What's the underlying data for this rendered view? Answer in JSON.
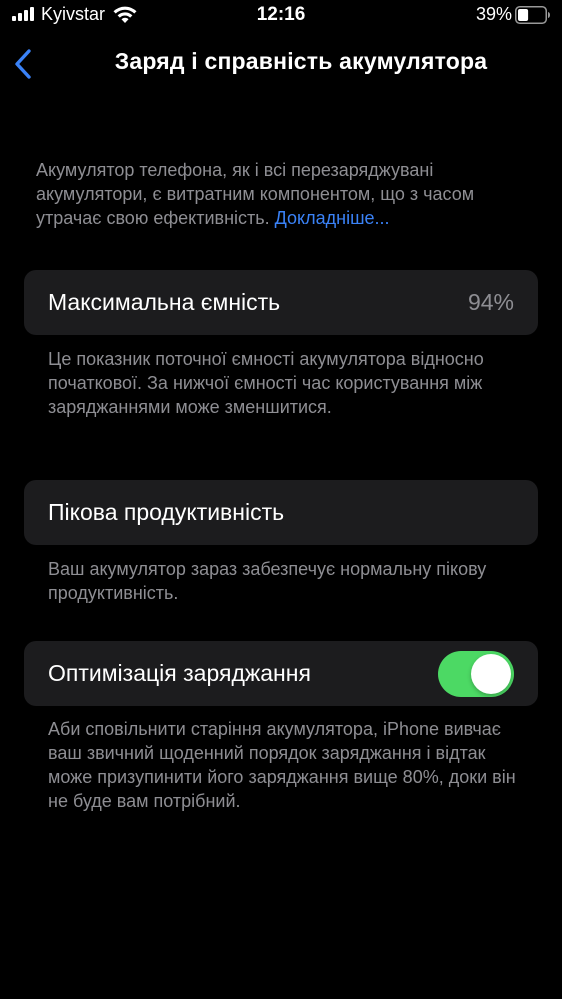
{
  "status_bar": {
    "carrier": "Kyivstar",
    "time": "12:16",
    "battery_percent": "39%",
    "battery_level": 0.39,
    "signal_icon": "signal-bars-icon",
    "wifi_icon": "wifi-icon",
    "battery_icon": "battery-icon"
  },
  "nav": {
    "title": "Заряд і справність акумулятора",
    "back_icon": "chevron-left-icon",
    "accent_color": "#3a82f7"
  },
  "intro": {
    "text": "Акумулятор телефона, як і всі перезаряджувані акумулятори, є витратним компонентом, що з часом утрачає свою ефективність. ",
    "link": "Докладніше..."
  },
  "max_capacity": {
    "label": "Максимальна ємність",
    "value": "94%",
    "note": "Це показник поточної ємності акумулятора відносно початкової. За нижчої ємності час користування між заряджаннями може зменшитися."
  },
  "peak_performance": {
    "label": "Пікова продуктивність",
    "note": "Ваш акумулятор зараз забезпечує нормальну пікову продуктивність."
  },
  "charging_optimization": {
    "label": "Оптимізація заряджання",
    "enabled": true,
    "toggle_color": "#4cd964",
    "note": "Аби сповільнити старіння акумулятора, iPhone вивчає ваш звичний щоденний порядок заряджання і відтак може призупинити його заряджання вище 80%, доки він не буде вам потрібний."
  }
}
